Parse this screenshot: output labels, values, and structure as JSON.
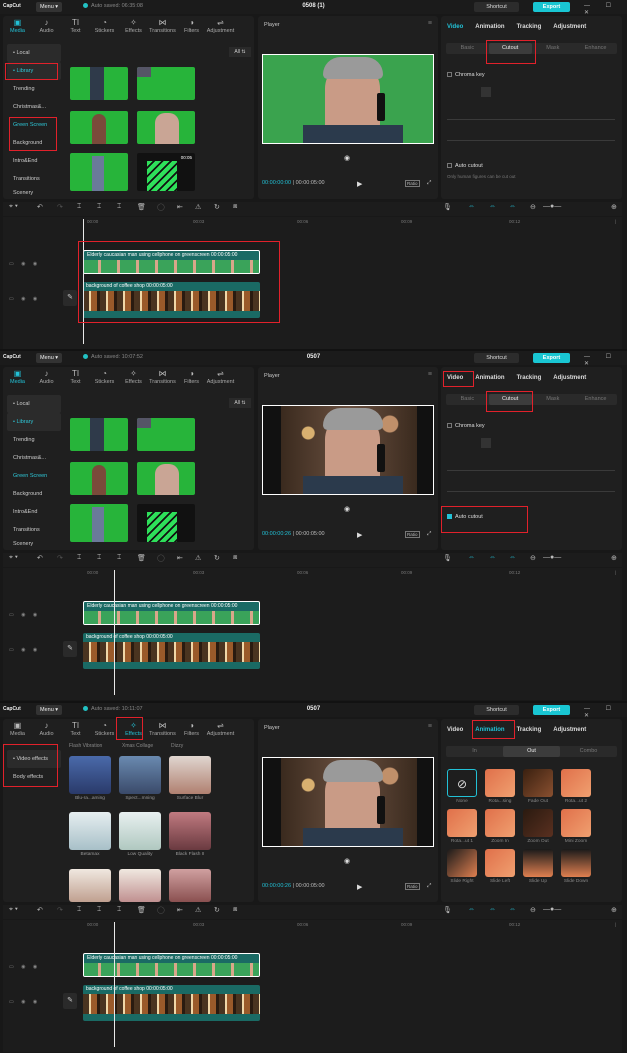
{
  "app": {
    "logo": "CapCut",
    "menu": "Menu",
    "shortcut": "Shortcut",
    "export": "Export",
    "win": "— ☐ ✕"
  },
  "screens": [
    {
      "autosave": "Auto saved: 06:35:08",
      "project": "0508 (1)",
      "time_current": "00:00:00:00",
      "time_total": "00:00:05:00"
    },
    {
      "autosave": "Auto saved: 10:07:52",
      "project": "0507",
      "time_current": "00:00:00:26",
      "time_total": "00:00:05:00"
    },
    {
      "autosave": "Auto saved: 10:11:07",
      "project": "0507",
      "time_current": "00:00:00:26",
      "time_total": "00:00:05:00"
    }
  ],
  "tools": [
    "Media",
    "Audio",
    "Text",
    "Stickers",
    "Effects",
    "Transitions",
    "Filters",
    "Adjustment"
  ],
  "media_categories": [
    "• Local",
    "• Library",
    "Trending",
    "Christmas&...",
    "Green Screen",
    "Background",
    "Intro&End",
    "Transitions",
    "Scenery"
  ],
  "all_btn": "All ⇅",
  "thumb_time": "00:05",
  "player_label": "Player",
  "ratio": "Ratio",
  "right_tabs": [
    "Video",
    "Animation",
    "Tracking",
    "Adjustment"
  ],
  "video_seg": [
    "Basic",
    "Cutout",
    "Mask",
    "Enhance"
  ],
  "chroma_key": "Chroma key",
  "auto_cutout": "Auto cutout",
  "auto_cutout_hint": "Only human figures can be cut out",
  "anim_seg": [
    "In",
    "Out",
    "Combo"
  ],
  "ruler": [
    "00:00",
    "00:03",
    "00:06",
    "00:09",
    "00:12",
    "|"
  ],
  "clip1_label": "Elderly caucasian man using cellphone on greenscreen     00:00:05:00",
  "clip2_label": "background of coffee shop     00:00:05:00",
  "effects_categories": [
    "• Video effects",
    "Body effects"
  ],
  "effects_top": [
    "Flash Vibration",
    "Xmas Collage",
    "Dizzy"
  ],
  "effects": [
    "Blu-ra...aming",
    "Spect...mning",
    "Surface Blur",
    "Betamax",
    "Low Quality",
    "Black Flash II",
    "",
    "",
    ""
  ],
  "animations": [
    "None",
    "Rota...sing",
    "Fade Out",
    "Rota...ut 2",
    "Rota...ut 1",
    "Zoom In",
    "Zoom Out",
    "Mini Zoom",
    "Slide Right",
    "Slide Left",
    "Slide Up",
    "Slide Down"
  ]
}
